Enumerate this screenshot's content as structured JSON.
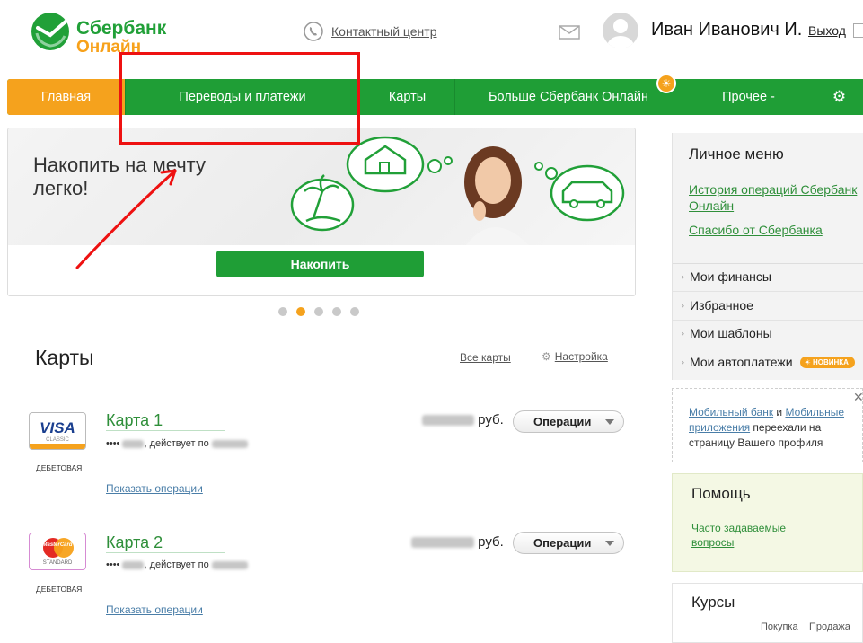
{
  "header": {
    "logo_line1": "Сбербанк",
    "logo_line2": "Онлайн",
    "contact_center": "Контактный центр",
    "user_name": "Иван Иванович И.",
    "logout": "Выход"
  },
  "nav": {
    "items": [
      {
        "label": "Главная",
        "active": true
      },
      {
        "label": "Переводы и платежи"
      },
      {
        "label": "Карты"
      },
      {
        "label": "Больше Сбербанк Онлайн"
      },
      {
        "label": "Прочее -"
      }
    ]
  },
  "banner": {
    "title": "Накопить на мечту легко!",
    "button": "Накопить",
    "slides_total": 5,
    "active_slide": 2
  },
  "cards": {
    "title": "Карты",
    "all_cards": "Все карты",
    "settings": "Настройка",
    "items": [
      {
        "logo_text": "VISA",
        "logo_sub": "CLASSIC",
        "type": "ДЕБЕТОВАЯ",
        "name": "Карта 1",
        "num_prefix": "••••",
        "valid_prefix": ", действует по",
        "currency": "руб.",
        "operations": "Операции",
        "show_operations": "Показать операции"
      },
      {
        "logo_text": "MasterCard",
        "logo_sub": "STANDARD",
        "type": "ДЕБЕТОВАЯ",
        "name": "Карта 2",
        "num_prefix": "••••",
        "valid_prefix": ", действует по",
        "currency": "руб.",
        "operations": "Операции",
        "show_operations": "Показать операции"
      }
    ]
  },
  "sidebar": {
    "title": "Личное меню",
    "links": [
      "История операций Сбербанк Онлайн",
      "Спасибо от Сбербанка"
    ],
    "items": [
      "Мои финансы",
      "Избранное",
      "Мои шаблоны",
      "Мои автоплатежи"
    ],
    "new_badge": "НОВИНКА"
  },
  "promo": {
    "link1": "Мобильный банк",
    "and": " и ",
    "link2": "Мобильные приложения",
    "text": " переехали на страницу Вашего профиля"
  },
  "help": {
    "title": "Помощь",
    "faq": "Часто задаваемые вопросы"
  },
  "rates": {
    "title": "Курсы",
    "buy": "Покупка",
    "sell": "Продажа"
  },
  "colors": {
    "brand_green": "#1f9e36",
    "accent_orange": "#f5a21d",
    "annotation_red": "#e11111"
  }
}
